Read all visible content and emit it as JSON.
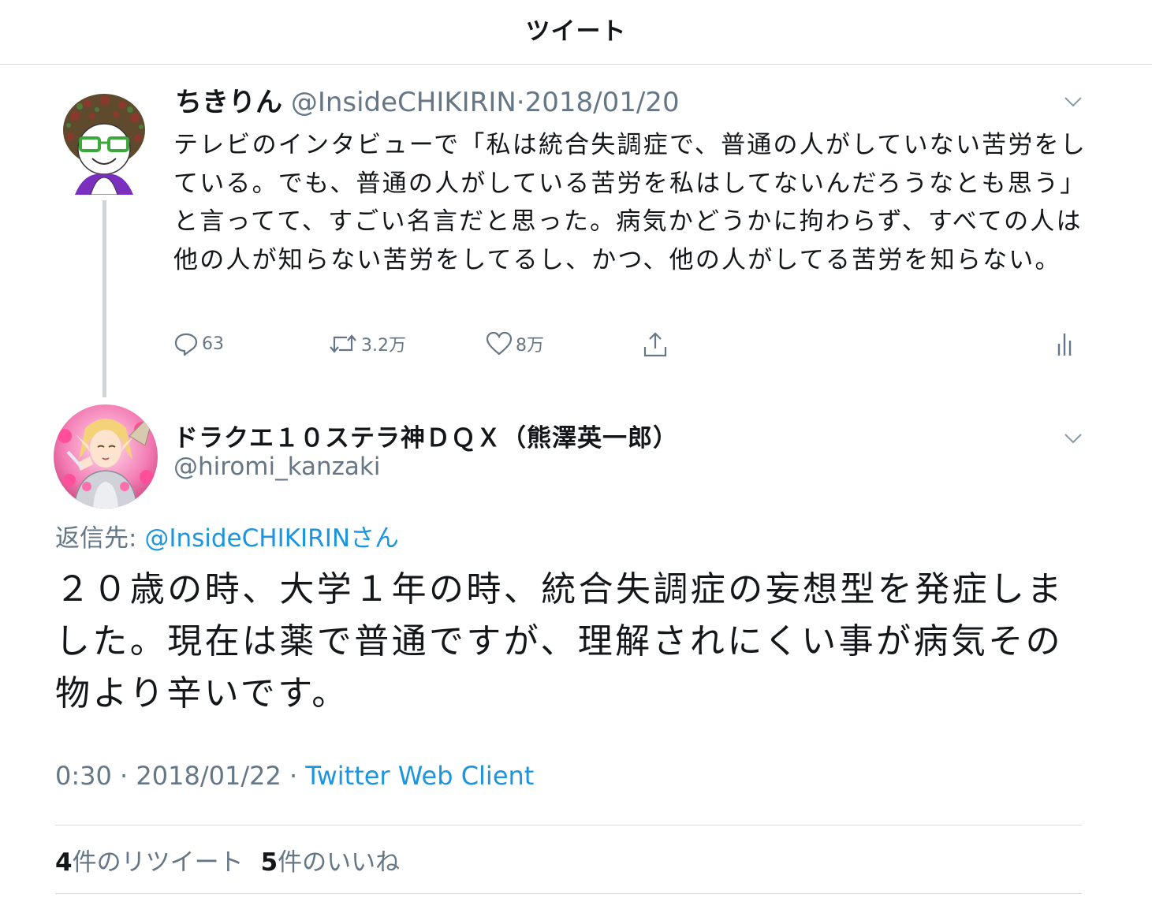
{
  "header": {
    "title": "ツイート"
  },
  "parent_tweet": {
    "display_name": "ちきりん",
    "handle": "@InsideCHIKIRIN",
    "separator": "·",
    "date": "2018/01/20",
    "text": "テレビのインタビューで「私は統合失調症で、普通の人がしていない苦労をしている。でも、普通の人がしている苦労を私はしてないんだろうなとも思う」と言ってて、すごい名言だと思った。病気かどうかに拘わらず、すべての人は他の人が知らない苦労をしてるし、かつ、他の人がしてる苦労を知らない。",
    "actions": {
      "reply_count": "63",
      "retweet_count": "3.2万",
      "like_count": "8万"
    },
    "icons": [
      "reply-icon",
      "retweet-icon",
      "like-icon",
      "share-icon",
      "analytics-icon",
      "chevron-down-icon"
    ]
  },
  "main_tweet": {
    "display_name": "ドラクエ１０ステラ神ＤＱＸ（熊澤英一郎）",
    "handle": "@hiromi_kanzaki",
    "reply_label": "返信先: ",
    "reply_mention": "@InsideCHIKIRINさん",
    "text": "２０歳の時、大学１年の時、統合失調症の妄想型を発症しました。現在は薬で普通ですが、理解されにくい事が病気その物より辛いです。",
    "time": "0:30 · 2018/01/22 · ",
    "client": "Twitter Web Client",
    "retweet_count": "4",
    "retweet_label": "件のリツイート",
    "like_count": "5",
    "like_label": "件のいいね"
  },
  "colors": {
    "text": "#14171a",
    "secondary": "#657786",
    "link": "#1b95e0",
    "divider": "#d6d9dc",
    "thread_line": "#cfd4d8"
  }
}
